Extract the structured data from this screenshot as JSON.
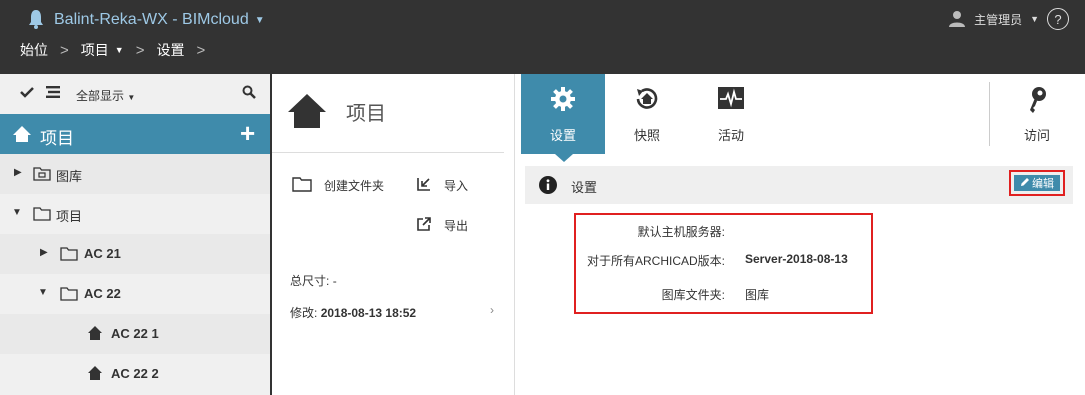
{
  "header": {
    "server_title": "Balint-Reka-WX - BIMcloud",
    "breadcrumbs": [
      "始位",
      "项目",
      "设置"
    ],
    "user": "主管理员",
    "help_glyph": "?"
  },
  "left": {
    "toolbar_label": "全部显示",
    "root_label": "项目",
    "add_symbol": "+",
    "tree": [
      {
        "label": "图库",
        "type": "library-folder",
        "expanded": false,
        "level": 0
      },
      {
        "label": "项目",
        "type": "folder",
        "expanded": true,
        "level": 0
      },
      {
        "label": "AC 21",
        "type": "folder",
        "expanded": false,
        "level": 1
      },
      {
        "label": "AC 22",
        "type": "folder",
        "expanded": true,
        "level": 1
      },
      {
        "label": "AC 22 1",
        "type": "project",
        "level": 2
      },
      {
        "label": "AC 22 2",
        "type": "project",
        "level": 2
      }
    ]
  },
  "middle": {
    "title": "项目",
    "actions": {
      "create_folder": "创建文件夹",
      "import": "导入",
      "export": "导出"
    },
    "total_size_label": "总尺寸:",
    "total_size_value": "-",
    "modified_label": "修改:",
    "modified_value": "2018-08-13 18:52"
  },
  "right": {
    "tabs": [
      {
        "label": "设置",
        "icon": "gear-icon",
        "active": true
      },
      {
        "label": "快照",
        "icon": "snapshot-icon",
        "active": false
      },
      {
        "label": "活动",
        "icon": "activity-icon",
        "active": false
      }
    ],
    "access_label": "访问",
    "section_title": "设置",
    "edit_label": "编辑",
    "settings": [
      {
        "key": "默认主机服务器:",
        "value": ""
      },
      {
        "key": "对于所有ARCHICAD版本:",
        "value": "Server-2018-08-13"
      },
      {
        "key": "图库文件夹:",
        "value": "图库"
      }
    ]
  },
  "colors": {
    "accent": "#3f8bab",
    "topbar": "#333333",
    "highlight": "#e02020"
  }
}
